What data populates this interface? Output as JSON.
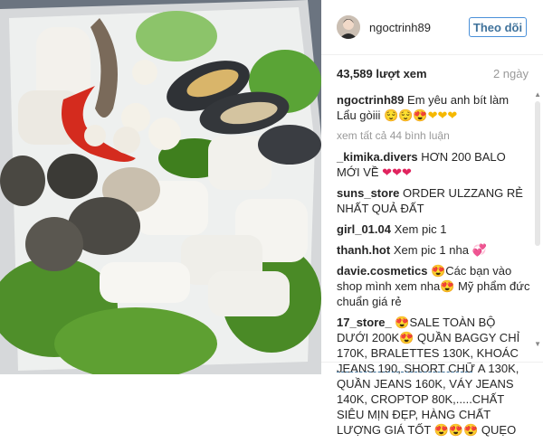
{
  "post": {
    "username": "ngoctrinh89",
    "follow_label": "Theo dõi",
    "views": "43,589 lượt xem",
    "time": "2 ngày"
  },
  "caption": {
    "username": "ngoctrinh89",
    "text": "Em yêu anh bít làm Lẩu gòiii",
    "emoji": "😌😌😍❤❤❤"
  },
  "more_comments": "xem tất cả 44 bình luận",
  "comments": [
    {
      "user": "_kimika.divers",
      "text": "HƠN 200 BALO MỚI VỀ",
      "emoji": "❤❤❤"
    },
    {
      "user": "suns_store",
      "text": "ORDER ULZZANG RẺ NHẤT QUẢ ĐẤT",
      "emoji": ""
    },
    {
      "user": "girl_01.04",
      "text": "Xem pic 1",
      "emoji": ""
    },
    {
      "user": "thanh.hot",
      "text": "Xem pic 1 nha",
      "emoji": "💞"
    },
    {
      "user": "davie.cosmetics",
      "text": "😍Các bạn vào shop mình xem nha😍 Mỹ phẩm đức chuẩn giá rẻ",
      "emoji": ""
    },
    {
      "user": "17_store_",
      "text": "😍SALE TOÀN BỘ DƯỚI 200K😍 QUẦN BAGGY CHỈ 170K, BRALETTES 130K, KHOÁC JEANS 190, SHORT CHỮ A 130K, QUẦN JEANS 160K, VÁY JEANS 140K, CROPTOP 80K,.....CHẤT SIÊU MỊN ĐẸP, HÀNG CHẤT LƯỢNG GIÁ TỐT 😍😍😍 QUẸO",
      "emoji": ""
    }
  ]
}
